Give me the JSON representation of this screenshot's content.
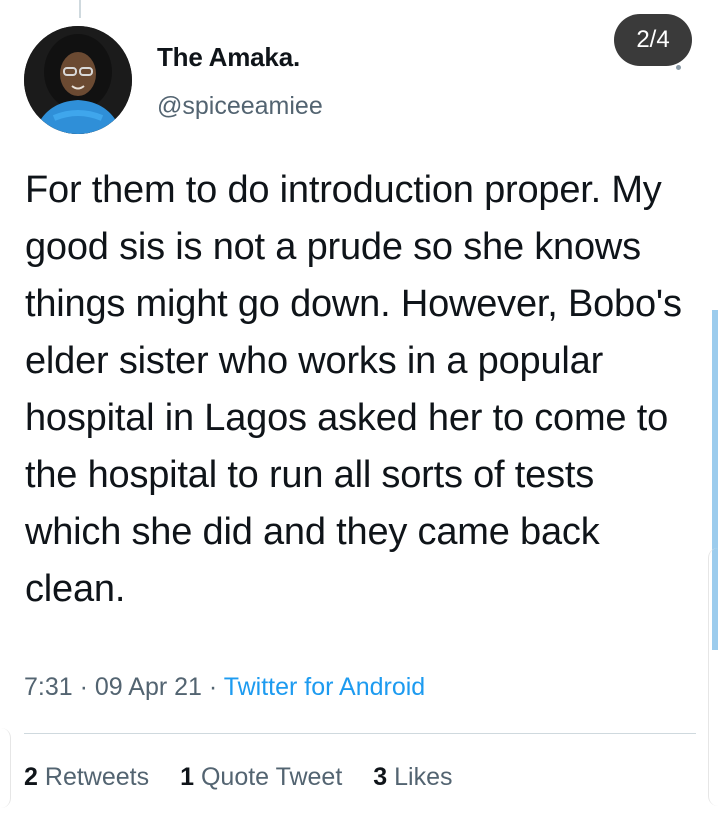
{
  "tweet": {
    "author": {
      "display_name": "The Amaka.",
      "handle": "@spiceeamiee"
    },
    "text": "For them to do introduction proper. My good sis is not a prude so she knows things might go down. However, Bobo's elder sister who works in a popular hospital in Lagos asked her to come to the hospital to run all sorts of tests which she did and they came back clean.",
    "time": "7:31",
    "date": "09 Apr 21",
    "separator": "·",
    "source": "Twitter for Android",
    "stats": {
      "retweets_count": "2",
      "retweets_label": "Retweets",
      "quotes_count": "1",
      "quotes_label": "Quote Tweet",
      "likes_count": "3",
      "likes_label": "Likes"
    }
  },
  "viewer": {
    "page_indicator": "2/4"
  },
  "icons": {
    "avatar": "profile-photo",
    "more": "more-dot-icon"
  },
  "colors": {
    "link": "#1d9bf0",
    "secondary_text": "#536471",
    "badge_bg": "#3a3a3a"
  }
}
